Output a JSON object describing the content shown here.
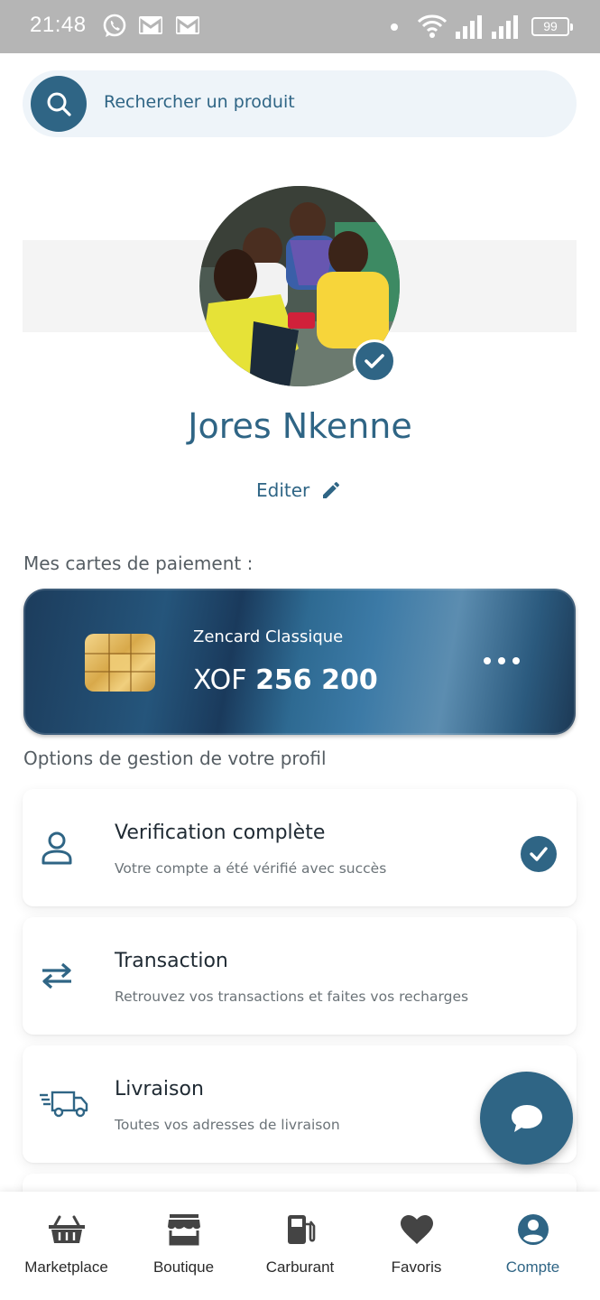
{
  "status_bar": {
    "time": "21:48",
    "battery": "99",
    "icons": [
      "whatsapp-icon",
      "gmail-icon",
      "gmail-icon",
      "notification-dot",
      "wifi-icon",
      "signal-icon",
      "signal-icon",
      "battery-icon"
    ]
  },
  "search": {
    "placeholder": "Rechercher un produit",
    "icon": "search-icon"
  },
  "profile": {
    "name": "Jores Nkenne",
    "verified": true,
    "edit_label": "Editer",
    "edit_icon": "pencil-icon"
  },
  "payment_section": {
    "label": "Mes cartes de paiement :",
    "card": {
      "name": "Zencard Classique",
      "currency": "XOF",
      "amount": "256 200",
      "menu_icon": "more-horizontal-icon"
    }
  },
  "options_section": {
    "label": "Options de gestion de votre profil",
    "items": [
      {
        "title": "Verification complète",
        "subtitle": "Votre compte a été vérifié avec succès",
        "icon": "user-icon",
        "checked": true
      },
      {
        "title": "Transaction",
        "subtitle": "Retrouvez vos transactions et faites vos recharges",
        "icon": "swap-arrows-icon"
      },
      {
        "title": "Livraison",
        "subtitle": "Toutes vos adresses de livraison",
        "icon": "delivery-truck-icon"
      }
    ]
  },
  "chat_fab": {
    "icon": "chat-bubble-icon"
  },
  "bottom_nav": {
    "active": "Compte",
    "items": [
      {
        "label": "Marketplace",
        "icon": "basket-icon"
      },
      {
        "label": "Boutique",
        "icon": "store-icon"
      },
      {
        "label": "Carburant",
        "icon": "fuel-pump-icon"
      },
      {
        "label": "Favoris",
        "icon": "heart-icon"
      },
      {
        "label": "Compte",
        "icon": "account-circle-icon"
      }
    ]
  },
  "colors": {
    "primary": "#2f6585",
    "status_bar": "#b5b5b5",
    "search_bg": "#eef4f9",
    "text_dark": "#1f2a33",
    "text_muted": "#6b7378"
  }
}
